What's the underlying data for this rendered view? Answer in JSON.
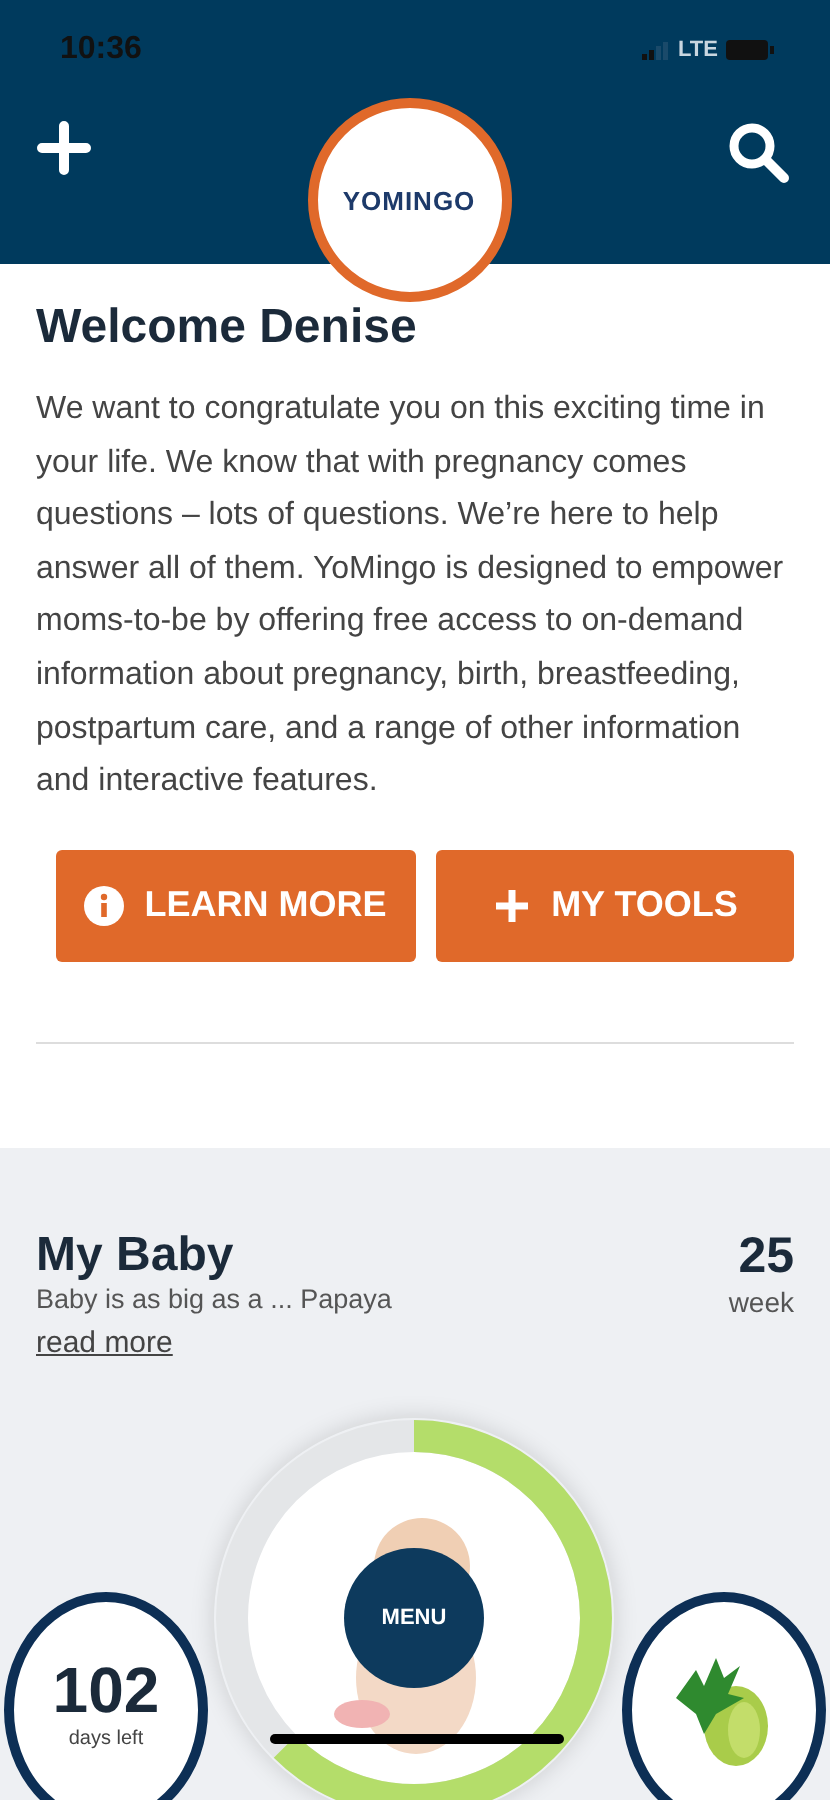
{
  "status_bar": {
    "time": "10:36",
    "network": "LTE"
  },
  "header": {
    "logo": "YOMINGO"
  },
  "welcome": {
    "title": "Welcome Denise",
    "body": "We want to congratulate you on this exciting time in your life. We know that with pregnancy comes questions – lots of questions. We’re here to help answer all of them. YoMingo is designed to empower moms-to-be by offering free access to on-demand information about pregnancy, birth, breastfeeding, postpartum care, and a range of other information and interactive features."
  },
  "buttons": [
    {
      "kind": "info",
      "label": "LEARN MORE"
    },
    {
      "kind": "plus",
      "label": "MY TOOLS"
    }
  ],
  "my_baby": {
    "title": "My Baby",
    "subtitle": "Baby is as big as a ... Papaya",
    "link": "read more",
    "week_number": "25",
    "week_label": "week",
    "days_left": "102",
    "days_label": "days left",
    "menu": "MENU"
  }
}
